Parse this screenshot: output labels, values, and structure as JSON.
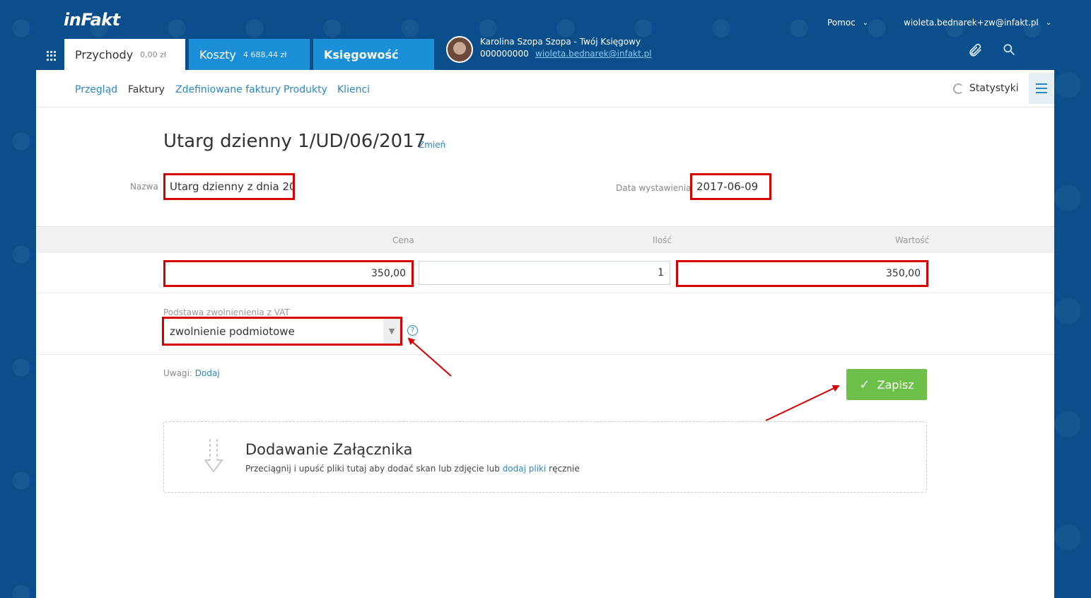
{
  "app": {
    "logo": "inFakt",
    "help_label": "Pomoc",
    "user_email": "wioleta.bednarek+zw@infakt.pl"
  },
  "tabs": [
    {
      "label": "Przychody",
      "amount": "0,00 zł"
    },
    {
      "label": "Koszty",
      "amount": "4 688,44 zł"
    },
    {
      "label": "Księgowość",
      "amount": ""
    }
  ],
  "accountant": {
    "name": "Karolina Szopa Szopa - Twój Księgowy",
    "phone": "000000000",
    "email": "wioleta.bednarek@infakt.pl"
  },
  "subnav": {
    "items": [
      "Przegląd",
      "Faktury",
      "Zdefiniowane faktury",
      "Produkty",
      "Klienci"
    ],
    "stats_label": "Statystyki"
  },
  "document": {
    "title": "Utarg dzienny 1/UD/06/2017",
    "change_label": "Zmień",
    "name_label": "Nazwa",
    "name_value": "Utarg dzienny z dnia 20",
    "date_label": "Data wystawienia",
    "date_value": "2017-06-09"
  },
  "table": {
    "headers": {
      "price": "Cena",
      "qty": "Ilość",
      "value": "Wartość"
    },
    "row": {
      "price": "350,00",
      "qty": "1",
      "value": "350,00"
    }
  },
  "vat": {
    "label": "Podstawa zwolnienienia z VAT",
    "selected": "zwolnienie podmiotowe",
    "info": "?"
  },
  "notes": {
    "label": "Uwagi:",
    "add": "Dodaj"
  },
  "save_label": "Zapisz",
  "attachment": {
    "title": "Dodawanie Załącznika",
    "text_before": "Przeciągnij i upuść pliki tutaj aby dodać skan lub zdjęcie lub",
    "link": "dodaj pliki",
    "text_after": "ręcznie"
  },
  "colors": {
    "brand_blue": "#0a4f8c",
    "tab_blue": "#1c8fd9",
    "link_blue": "#2a86c7",
    "highlight_red": "#d60000",
    "save_green": "#6cc04a"
  }
}
